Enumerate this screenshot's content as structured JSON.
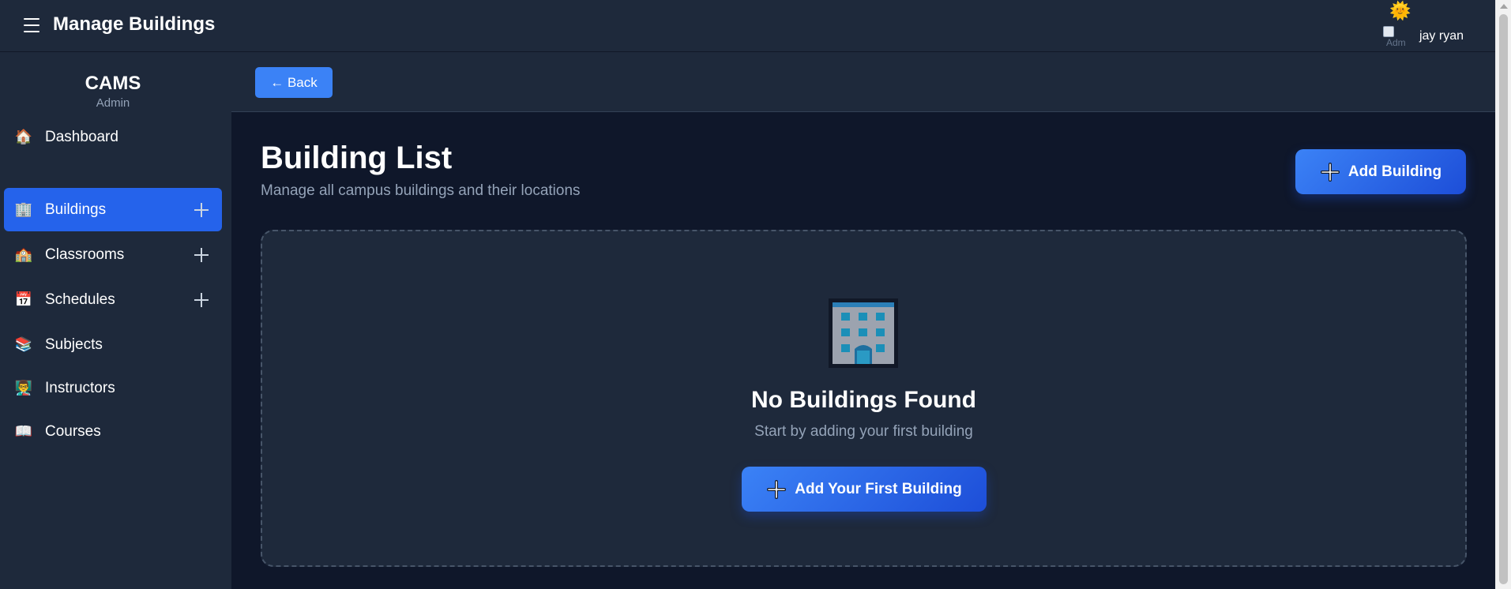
{
  "header": {
    "title": "Manage Buildings",
    "user": {
      "name": "jay ryan",
      "avatar_alt": "Adm",
      "theme_icon": "sun-icon"
    }
  },
  "sidebar": {
    "brand": "CAMS",
    "role": "Admin",
    "items": [
      {
        "label": "Dashboard",
        "icon": "home-icon",
        "active": false,
        "has_add": false
      },
      {
        "label": "Buildings",
        "icon": "office-building-icon",
        "active": true,
        "has_add": true
      },
      {
        "label": "Classrooms",
        "icon": "school-icon",
        "active": false,
        "has_add": true
      },
      {
        "label": "Schedules",
        "icon": "calendar-icon",
        "active": false,
        "has_add": true
      },
      {
        "label": "Subjects",
        "icon": "books-icon",
        "active": false,
        "has_add": false
      },
      {
        "label": "Instructors",
        "icon": "teacher-icon",
        "active": false,
        "has_add": false
      },
      {
        "label": "Courses",
        "icon": "open-book-icon",
        "active": false,
        "has_add": false
      }
    ]
  },
  "toolbar": {
    "back_label": "← Back"
  },
  "main": {
    "title": "Building List",
    "subtitle": "Manage all campus buildings and their locations",
    "add_button_label": "Add Building",
    "empty_state": {
      "icon": "office-building-icon",
      "title": "No Buildings Found",
      "text": "Start by adding your first building",
      "button_label": "Add Your First Building"
    }
  },
  "colors": {
    "accent": "#2563eb",
    "background": "#0f172a",
    "panel": "#1e293b",
    "muted_text": "#94a3b8"
  }
}
